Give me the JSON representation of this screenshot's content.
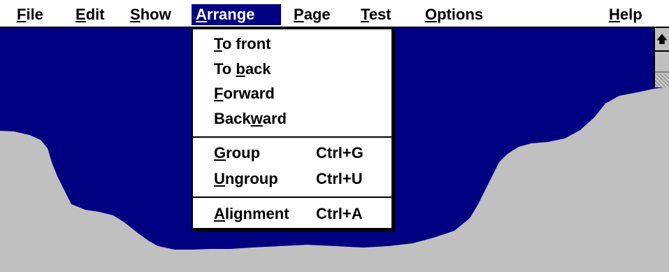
{
  "menubar": {
    "items": [
      {
        "pre": "",
        "acc": "F",
        "post": "ile"
      },
      {
        "pre": "",
        "acc": "E",
        "post": "dit"
      },
      {
        "pre": "",
        "acc": "S",
        "post": "how"
      },
      {
        "pre": "",
        "acc": "A",
        "post": "rrange"
      },
      {
        "pre": "",
        "acc": "P",
        "post": "age"
      },
      {
        "pre": "",
        "acc": "T",
        "post": "est"
      },
      {
        "pre": "",
        "acc": "O",
        "post": "ptions"
      },
      {
        "pre": "",
        "acc": "H",
        "post": "elp"
      }
    ],
    "active_index": 3
  },
  "arrange_menu": {
    "items": [
      {
        "pre": "",
        "acc": "T",
        "post": "o front",
        "shortcut": ""
      },
      {
        "pre": "To ",
        "acc": "b",
        "post": "ack",
        "shortcut": ""
      },
      {
        "pre": "",
        "acc": "F",
        "post": "orward",
        "shortcut": ""
      },
      {
        "pre": "Back",
        "acc": "w",
        "post": "ard",
        "shortcut": ""
      },
      {
        "pre": "",
        "acc": "G",
        "post": "roup",
        "shortcut": "Ctrl+G"
      },
      {
        "pre": "",
        "acc": "U",
        "post": "ngroup",
        "shortcut": "Ctrl+U"
      },
      {
        "pre": "",
        "acc": "A",
        "post": "lignment",
        "shortcut": "Ctrl+A"
      }
    ]
  },
  "scrollbar": {
    "up_icon": "scroll-up-arrow-icon"
  },
  "colors": {
    "water": "#000080",
    "land": "#c0c0c0",
    "menu_highlight": "#000080",
    "menu_bg": "#ffffff"
  }
}
